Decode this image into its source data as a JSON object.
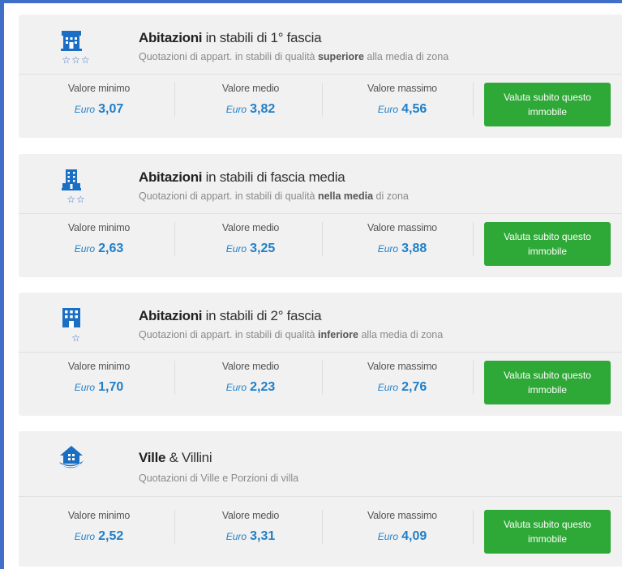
{
  "labels": {
    "min": "Valore minimo",
    "avg": "Valore medio",
    "max": "Valore massimo",
    "currency": "Euro",
    "cta": "Valuta subito questo immobile"
  },
  "colors": {
    "accent_blue": "#1f7fc9",
    "icon_blue": "#1a6fc4",
    "button_green": "#2ea836",
    "frame_blue": "#3f6fc7"
  },
  "cards": [
    {
      "icon": "building-fascia1-icon",
      "stars": "☆☆☆",
      "title_bold": "Abitazioni",
      "title_rest": " in stabili di 1° fascia",
      "sub_pre": "Quotazioni di appart. in stabili di qualità ",
      "sub_bold": "superiore",
      "sub_post": " alla media di zona",
      "min": "3,07",
      "avg": "3,82",
      "max": "4,56"
    },
    {
      "icon": "building-media-icon",
      "stars": "☆☆",
      "title_bold": "Abitazioni",
      "title_rest": " in stabili di fascia media",
      "sub_pre": "Quotazioni di appart. in stabili di qualità ",
      "sub_bold": "nella media",
      "sub_post": " di zona",
      "min": "2,63",
      "avg": "3,25",
      "max": "3,88"
    },
    {
      "icon": "building-fascia2-icon",
      "stars": "☆",
      "title_bold": "Abitazioni",
      "title_rest": " in stabili di 2° fascia",
      "sub_pre": "Quotazioni di appart. in stabili di qualità ",
      "sub_bold": "inferiore",
      "sub_post": " alla media di zona",
      "min": "1,70",
      "avg": "2,23",
      "max": "2,76"
    },
    {
      "icon": "villa-icon",
      "stars": "",
      "title_bold": "Ville",
      "title_rest": " & Villini",
      "sub_pre": "Quotazioni di Ville e Porzioni di villa",
      "sub_bold": "",
      "sub_post": "",
      "min": "2,52",
      "avg": "3,31",
      "max": "4,09"
    }
  ]
}
